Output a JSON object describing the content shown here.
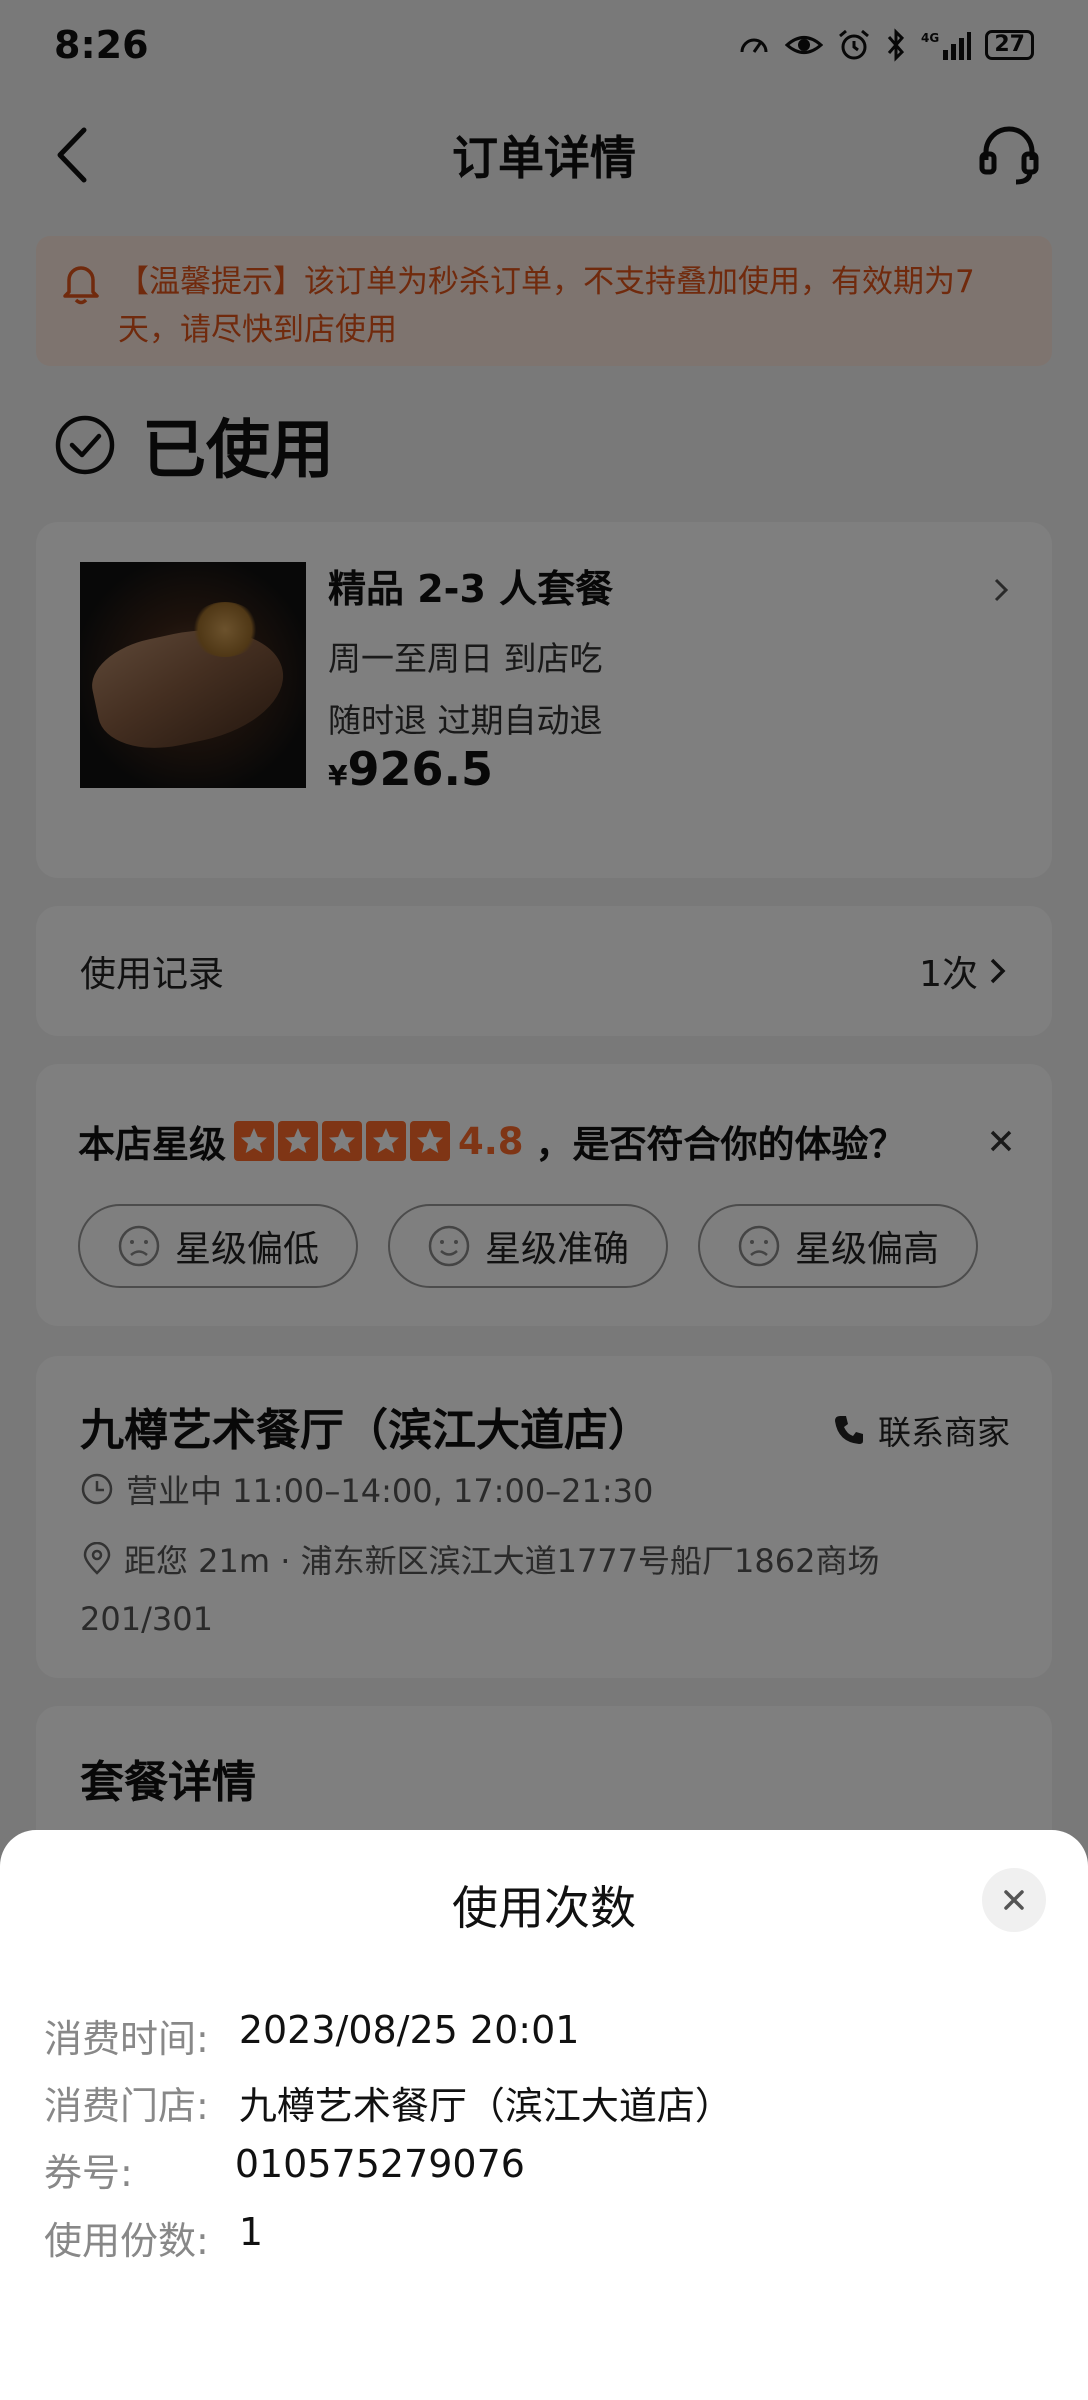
{
  "status_bar": {
    "time": "8:26",
    "battery": "27"
  },
  "header": {
    "title": "订单详情"
  },
  "notice": {
    "text": "【温馨提示】该订单为秒杀订单，不支持叠加使用，有效期为7天，请尽快到店使用"
  },
  "order_status": {
    "text": "已使用"
  },
  "product": {
    "name": "精品 2-3 人套餐",
    "tag1": "周一至周日   到店吃",
    "tag2": "随时退   过期自动退",
    "price_symbol": "¥",
    "price": "926.5"
  },
  "usage_record": {
    "label": "使用记录",
    "count": "1次"
  },
  "rating": {
    "label": "本店星级",
    "score": "4.8",
    "question": "，是否符合你的体验？",
    "stars": 5,
    "options": [
      "星级偏低",
      "星级准确",
      "星级偏高"
    ]
  },
  "store": {
    "name": "九樽艺术餐厅（滨江大道店）",
    "contact": "联系商家",
    "hours": "营业中 11:00–14:00, 17:00–21:30",
    "address": "距您 21m · 浦东新区滨江大道1777号船厂1862商场201/301"
  },
  "package": {
    "title": "套餐详情"
  },
  "sheet": {
    "title": "使用次数",
    "rows": [
      {
        "label": "消费时间:",
        "value": "2023/08/25 20:01"
      },
      {
        "label": "消费门店:",
        "value": "九樽艺术餐厅（滨江大道店）"
      },
      {
        "label": "券号:",
        "value": "010575279076"
      },
      {
        "label": "使用份数:",
        "value": "1"
      }
    ]
  },
  "colors": {
    "accent": "#ff6a2b",
    "notice_bg": "#fde9df",
    "notice_text": "#e0541b"
  }
}
